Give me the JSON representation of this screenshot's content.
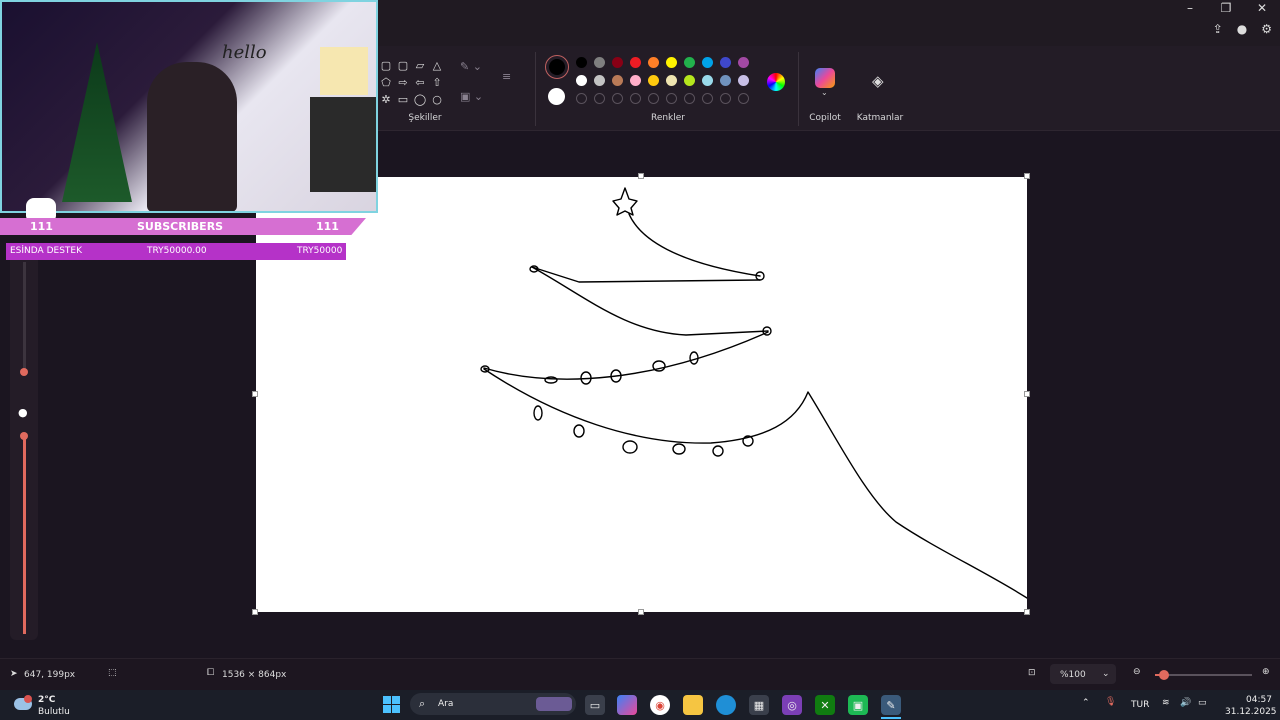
{
  "ribbon": {
    "shapes_label": "Şekiller",
    "colors_label": "Renkler",
    "copilot_label": "Copilot",
    "layers_label": "Katmanlar",
    "palette_row1": [
      "#000000",
      "#7f7f7f",
      "#880015",
      "#ed1c24",
      "#ff7f27",
      "#fff200",
      "#22b14c",
      "#00a2e8",
      "#3f48cc",
      "#a349a4"
    ],
    "palette_row2": [
      "#ffffff",
      "#c3c3c3",
      "#b97a57",
      "#ffaec9",
      "#ffc90e",
      "#efe4b0",
      "#b5e61d",
      "#99d9ea",
      "#7092be",
      "#c8bfe7"
    ]
  },
  "overlay": {
    "subs_count_left": "111",
    "subs_label": "SUBSCRIBERS",
    "subs_count_right": "111",
    "donate_label": "ESİNDA DESTEK",
    "donate_value": "TRY50000.00",
    "donate_goal": "TRY50000"
  },
  "status": {
    "cursor_pos": "647, 199px",
    "canvas_size": "1536 × 864px",
    "zoom": "%100",
    "zoom_fraction": 0.09
  },
  "taskbar": {
    "weather_temp": "2°C",
    "weather_desc": "Bulutlu",
    "search_placeholder": "Ara",
    "language": "TUR",
    "time": "04:57",
    "date": "31.12.2025"
  }
}
